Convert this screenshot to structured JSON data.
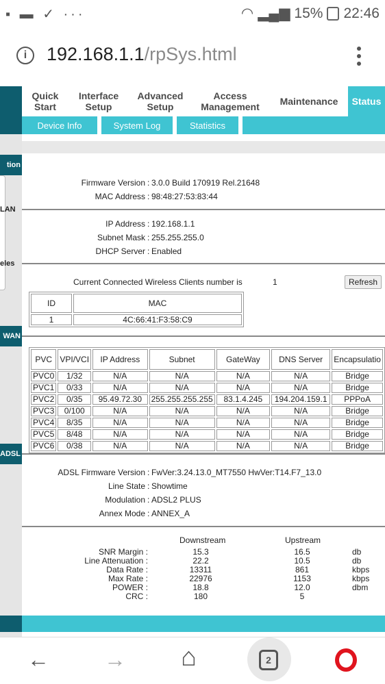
{
  "status_bar": {
    "left_icons": "▪ ▬ ✓ ···",
    "battery_text": "15%",
    "time": "22:46"
  },
  "url_bar": {
    "host": "192.168.1.1",
    "path": "/rpSys.html"
  },
  "nav": {
    "items": [
      {
        "label": "Quick\nStart"
      },
      {
        "label": "Interface\nSetup"
      },
      {
        "label": "Advanced\nSetup"
      },
      {
        "label": "Access\nManagement"
      },
      {
        "label": "Maintenance"
      },
      {
        "label": "Status"
      }
    ],
    "sub_items": [
      {
        "label": "Device Info"
      },
      {
        "label": "System Log"
      },
      {
        "label": "Statistics"
      }
    ]
  },
  "sections": {
    "device_label": "tion",
    "lan_label": "LAN",
    "wireless_label": "eless",
    "wan_label": "WAN",
    "adsl_label": "ADSL"
  },
  "device_info": {
    "firmware_label": "Firmware Version",
    "firmware_value": "3.0.0 Build 170919 Rel.21648",
    "mac_label": "MAC Address",
    "mac_value": "98:48:27:53:83:44"
  },
  "lan": {
    "ip_label": "IP Address",
    "ip_value": "192.168.1.1",
    "subnet_label": "Subnet Mask",
    "subnet_value": "255.255.255.0",
    "dhcp_label": "DHCP Server",
    "dhcp_value": "Enabled"
  },
  "wireless": {
    "clients_label": "Current Connected Wireless Clients number is",
    "clients_count": "1",
    "refresh_label": "Refresh",
    "table_headers": [
      "ID",
      "MAC"
    ],
    "rows": [
      [
        "1",
        "4C:66:41:F3:58:C9"
      ]
    ]
  },
  "wan": {
    "headers": [
      "PVC",
      "VPI/VCI",
      "IP Address",
      "Subnet",
      "GateWay",
      "DNS Server",
      "Encapsulatio"
    ],
    "rows": [
      [
        "PVC0",
        "1/32",
        "N/A",
        "N/A",
        "N/A",
        "N/A",
        "Bridge"
      ],
      [
        "PVC1",
        "0/33",
        "N/A",
        "N/A",
        "N/A",
        "N/A",
        "Bridge"
      ],
      [
        "PVC2",
        "0/35",
        "95.49.72.30",
        "255.255.255.255",
        "83.1.4.245",
        "194.204.159.1",
        "PPPoA"
      ],
      [
        "PVC3",
        "0/100",
        "N/A",
        "N/A",
        "N/A",
        "N/A",
        "Bridge"
      ],
      [
        "PVC4",
        "8/35",
        "N/A",
        "N/A",
        "N/A",
        "N/A",
        "Bridge"
      ],
      [
        "PVC5",
        "8/48",
        "N/A",
        "N/A",
        "N/A",
        "N/A",
        "Bridge"
      ],
      [
        "PVC6",
        "0/38",
        "N/A",
        "N/A",
        "N/A",
        "N/A",
        "Bridge"
      ]
    ]
  },
  "adsl": {
    "fw_label": "ADSL Firmware Version",
    "fw_value": "FwVer:3.24.13.0_MT7550 HwVer:T14.F7_13.0",
    "line_label": "Line State",
    "line_value": "Showtime",
    "mod_label": "Modulation",
    "mod_value": "ADSL2 PLUS",
    "annex_label": "Annex Mode",
    "annex_value": "ANNEX_A",
    "downstream_header": "Downstream",
    "upstream_header": "Upstream",
    "stats": [
      {
        "label": "SNR Margin :",
        "down": "15.3",
        "up": "16.5",
        "unit": "db"
      },
      {
        "label": "Line Attenuation :",
        "down": "22.2",
        "up": "10.5",
        "unit": "db"
      },
      {
        "label": "Data Rate :",
        "down": "13311",
        "up": "861",
        "unit": "kbps"
      },
      {
        "label": "Max Rate :",
        "down": "22976",
        "up": "1153",
        "unit": "kbps"
      },
      {
        "label": "POWER :",
        "down": "18.8",
        "up": "12.0",
        "unit": "dbm"
      },
      {
        "label": "CRC :",
        "down": "180",
        "up": "5",
        "unit": ""
      }
    ]
  },
  "bottom_nav": {
    "tab_count": "2",
    "back_icon": "←",
    "forward_icon": "→",
    "home_icon": "⌂"
  }
}
